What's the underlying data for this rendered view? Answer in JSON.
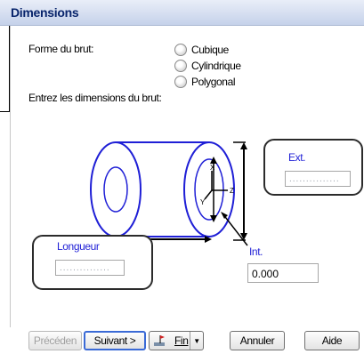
{
  "window": {
    "title": "Dimensions"
  },
  "shape": {
    "label": "Forme du brut:",
    "options": [
      "Cubique",
      "Cylindrique",
      "Polygonal"
    ]
  },
  "dimensions": {
    "prompt": "Entrez les dimensions du brut:",
    "ext_label": "Ext.",
    "ext_value": "...............",
    "int_label": "Int.",
    "int_value": "0.000",
    "length_label": "Longueur",
    "length_value": "...............",
    "axis_labels": {
      "x": "X",
      "y": "Y",
      "z": "Z"
    }
  },
  "buttons": {
    "previous": "Précéden",
    "next": "Suivant >",
    "finish": "Fin",
    "cancel": "Annuler",
    "help": "Aide"
  },
  "colors": {
    "drawing": "#1f1fd6",
    "title_text": "#08246b",
    "focus": "#3a6ad6"
  }
}
